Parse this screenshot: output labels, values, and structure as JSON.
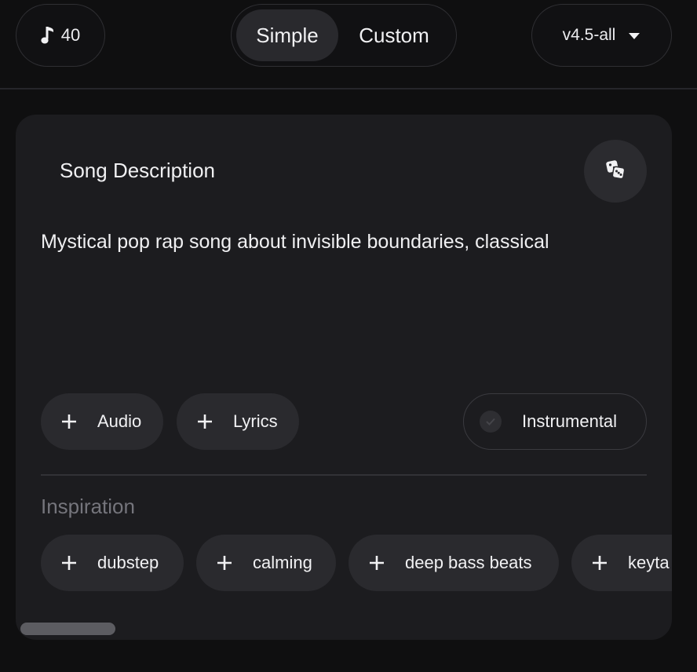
{
  "topbar": {
    "credits": "40",
    "modes": [
      "Simple",
      "Custom"
    ],
    "active_mode": "Simple",
    "model": "v4.5-all"
  },
  "card": {
    "title": "Song Description",
    "description": "Mystical pop rap song about invisible boundaries, classical",
    "chips": {
      "audio": "Audio",
      "lyrics": "Lyrics"
    },
    "instrumental_label": "Instrumental",
    "instrumental_checked": false,
    "inspiration_label": "Inspiration",
    "inspiration_tags": [
      "dubstep",
      "calming",
      "deep bass beats",
      "keyta"
    ]
  },
  "colors": {
    "background": "#0f0f10",
    "card": "#1c1c1f",
    "chip": "#2a2a2e",
    "text": "#f0f0f2",
    "muted": "#75757c"
  },
  "icons": {
    "credits": "music-note-icon",
    "model": "caret-down-icon",
    "random": "dice-icon",
    "add": "plus-icon",
    "instrumental": "check-icon"
  }
}
